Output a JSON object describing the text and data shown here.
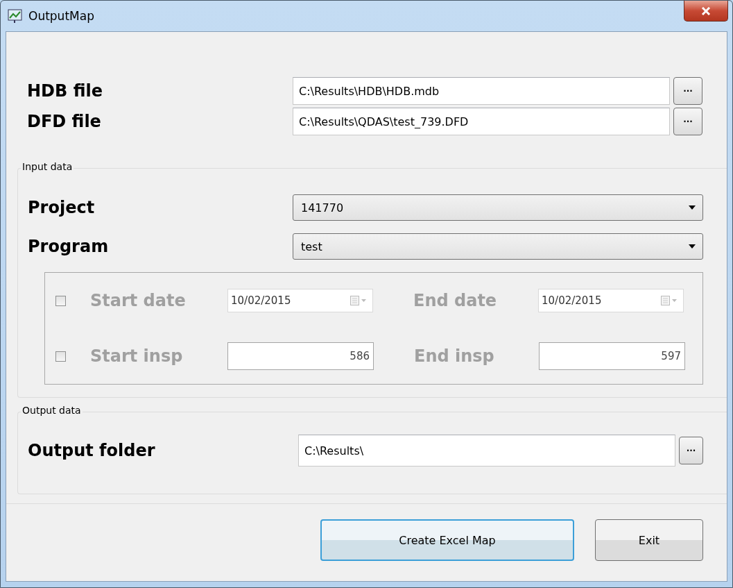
{
  "window": {
    "title": "OutputMap"
  },
  "files": [
    {
      "label": "HDB file",
      "value": "C:\\Results\\HDB\\HDB.mdb",
      "browse": "..."
    },
    {
      "label": "DFD file",
      "value": "C:\\Results\\QDAS\\test_739.DFD",
      "browse": "..."
    }
  ],
  "input_data": {
    "title": "Input data",
    "selectors": [
      {
        "label": "Project",
        "value": "141770"
      },
      {
        "label": "Program",
        "value": "test"
      }
    ],
    "filters": [
      {
        "kind": "date",
        "checked": false,
        "disabled": true,
        "start_label": "Start date",
        "start_value": "10/02/2015",
        "end_label": "End date",
        "end_value": "10/02/2015"
      },
      {
        "kind": "number",
        "checked": false,
        "disabled": true,
        "start_label": "Start insp",
        "start_value": "586",
        "end_label": "End insp",
        "end_value": "597"
      }
    ]
  },
  "output_data": {
    "title": "Output data",
    "label": "Output folder",
    "value": "C:\\Results\\",
    "browse": "..."
  },
  "buttons": [
    {
      "label": "Create Excel Map",
      "focused": true
    },
    {
      "label": "Exit",
      "focused": false
    }
  ]
}
